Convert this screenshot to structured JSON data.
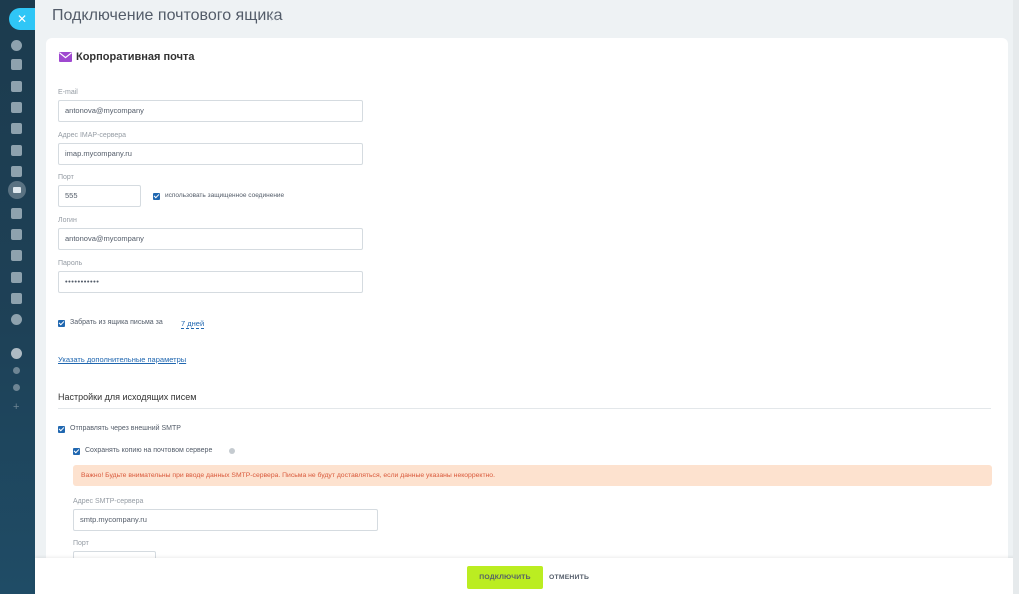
{
  "page": {
    "title": "Подключение почтового ящика"
  },
  "section": {
    "title": "Корпоративная почта"
  },
  "fields": {
    "email": {
      "label": "E-mail",
      "value": "antonova@mycompany"
    },
    "imap": {
      "label": "Адрес IMAP-сервера",
      "value": "imap.mycompany.ru"
    },
    "port": {
      "label": "Порт",
      "value": "555"
    },
    "secure": {
      "label": "использовать защищенное соединение",
      "checked": true
    },
    "login": {
      "label": "Логин",
      "value": "antonova@mycompany"
    },
    "password": {
      "label": "Пароль",
      "value": "•••••••••••"
    }
  },
  "fetch": {
    "label": "Забрать из ящика письма за",
    "period": "7 дней",
    "checked": true
  },
  "advanced_link": "Указать дополнительные параметры",
  "outgoing": {
    "title": "Настройки для исходящих писем",
    "smtp_external": {
      "label": "Отправлять через внешний SMTP",
      "checked": true
    },
    "save_copy": {
      "label": "Сохранять копию на почтовом сервере",
      "checked": true
    },
    "warning": "Важно! Будьте внимательны при вводе данных SMTP-сервера. Письма не будут доставляться, если данные указаны некорректно.",
    "smtp_server": {
      "label": "Адрес SMTP-сервера",
      "value": "smtp.mycompany.ru"
    },
    "port": {
      "label": "Порт"
    }
  },
  "footer": {
    "connect": "ПОДКЛЮЧИТЬ",
    "cancel": "ОТМЕНИТЬ"
  },
  "colors": {
    "accent": "#2067b0",
    "connect": "#bbed21",
    "sidebar": "#1e4157",
    "warning_bg": "#fde2cf",
    "warning_text": "#d9593b"
  }
}
